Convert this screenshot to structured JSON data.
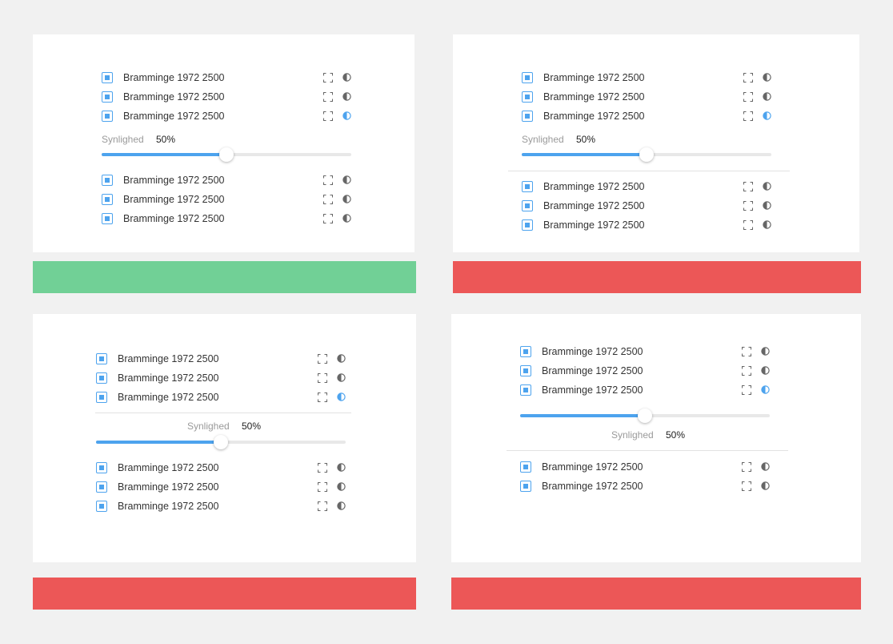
{
  "layer_label": "Bramminge 1972 2500",
  "slider": {
    "label": "Synlighed",
    "value_text": "50%",
    "value": 0.5
  },
  "colors": {
    "accent": "#4da3ee",
    "good": "#71d096",
    "bad": "#ec5757",
    "icon_gray": "#666666"
  },
  "variants": [
    {
      "status": "good"
    },
    {
      "status": "bad"
    },
    {
      "status": "bad"
    },
    {
      "status": "bad"
    }
  ]
}
